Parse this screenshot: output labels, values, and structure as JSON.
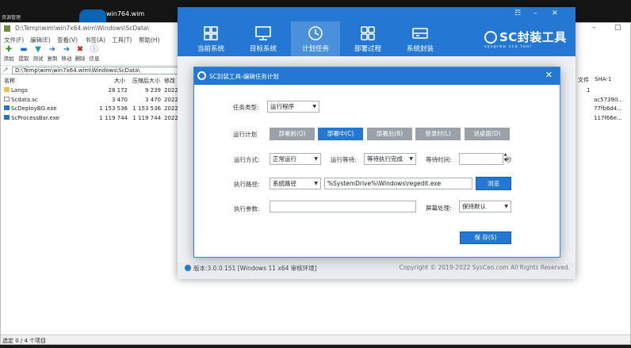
{
  "taskbar": {
    "tiny_label": "资源管理",
    "task_title": "win764.wim"
  },
  "file_manager": {
    "title": "D:\\Temp\\wim\\win7x64.wim\\Windows\\ScData\\",
    "menu": [
      "文件(F)",
      "编辑(E)",
      "查看(V)",
      "书签(A)",
      "工具(T)",
      "帮助(H)"
    ],
    "toolbar": [
      "添加",
      "提取",
      "测试",
      "复制",
      "移动",
      "删除",
      "信息"
    ],
    "address": "D:\\Temp\\wim\\win7x64.wim\\Windows\\ScData\\",
    "columns": [
      "名称",
      "大小",
      "压缩后大小",
      "修改"
    ],
    "right_columns": [
      "文件",
      "SHA-1"
    ],
    "rows": [
      {
        "name": "Langs",
        "size": "28 172",
        "packed": "9 239",
        "modified": "2022",
        "files": "1",
        "sha1": ""
      },
      {
        "name": "Scdata.sc",
        "size": "3 470",
        "packed": "3 470",
        "modified": "2022",
        "files": "",
        "sha1": "ac57390..."
      },
      {
        "name": "ScDeployBG.exe",
        "size": "1 153 536",
        "packed": "1 153 536",
        "modified": "2022",
        "files": "",
        "sha1": "77fb6d4..."
      },
      {
        "name": "ScProcessBar.exe",
        "size": "1 119 744",
        "packed": "1 119 744",
        "modified": "2022",
        "files": "",
        "sha1": "117f66e..."
      }
    ],
    "status": "选定 0 / 4 个项目"
  },
  "sc_window": {
    "nav": [
      "当前系统",
      "目标系统",
      "计划任务",
      "部署过程",
      "系统封装"
    ],
    "active_nav": "计划任务",
    "logo_main": "SC封装工具",
    "logo_sub": "sysprep cco tool",
    "version": "版本:3.0.0.151 [Windows 11 x64 审核环境]",
    "copyright": "Copyright © 2019-2022 SysCeo.com All Rights Reserved.",
    "window_buttons": [
      "☶",
      "–",
      "✕"
    ]
  },
  "dialog": {
    "title": "SC封装工具-编辑任务计划",
    "task_type_label": "任务类型:",
    "task_type_value": "运行程序",
    "run_plan_label": "运行计划",
    "plans": [
      "部署前(Q)",
      "部署中(C)",
      "部署后(B)",
      "登录时(L)",
      "进桌面(D)"
    ],
    "active_plan": "部署中(C)",
    "run_mode_label": "运行方式:",
    "run_mode_value": "正常运行",
    "run_wait_label": "运行等待:",
    "run_wait_value": "等待执行完成",
    "wait_time_label": "等待时间:",
    "wait_time_value": "",
    "seconds_unit": "秒",
    "exec_path_label": "执行路径:",
    "path_type_value": "系统路径",
    "path_value": "%SystemDrive%\\Windows\\regedit.exe",
    "browse_label": "浏览",
    "params_label": "执行参数:",
    "params_value": "",
    "screen_label": "屏幕处理:",
    "screen_value": "保持默认",
    "save_label": "保 存(S)"
  }
}
